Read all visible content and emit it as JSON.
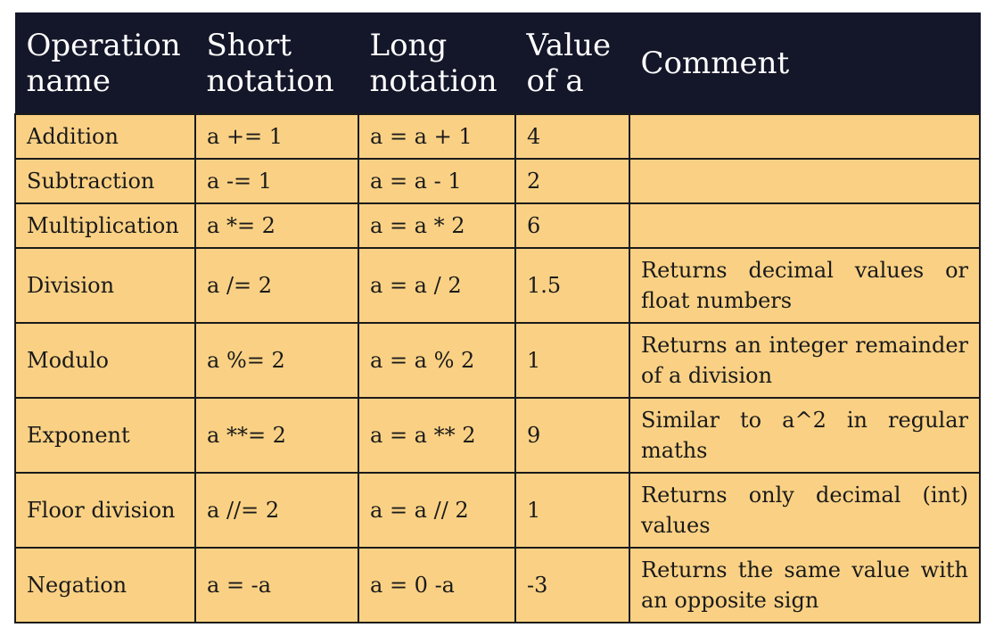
{
  "columns": [
    "Operation name",
    "Short notation",
    "Long notation",
    "Value of a",
    "Comment"
  ],
  "rows": [
    {
      "name": "Addition",
      "short": "a += 1",
      "long": "a = a + 1",
      "value": "4",
      "comment": ""
    },
    {
      "name": "Subtraction",
      "short": "a -= 1",
      "long": "a = a - 1",
      "value": "2",
      "comment": ""
    },
    {
      "name": "Multiplication",
      "short": "a *= 2",
      "long": "a = a * 2",
      "value": "6",
      "comment": ""
    },
    {
      "name": "Division",
      "short": "a /= 2",
      "long": "a = a / 2",
      "value": "1.5",
      "comment": "Returns decimal values or float numbers"
    },
    {
      "name": "Modulo",
      "short": "a %= 2",
      "long": "a = a % 2",
      "value": "1",
      "comment": "Returns an integer remainder of a division"
    },
    {
      "name": "Exponent",
      "short": "a **= 2",
      "long": "a = a ** 2",
      "value": "9",
      "comment": "Similar to a^2 in regular maths"
    },
    {
      "name": "Floor division",
      "short": "a //= 2",
      "long": "a = a // 2",
      "value": "1",
      "comment": "Returns only decimal (int) values"
    },
    {
      "name": "Negation",
      "short": "a = -a",
      "long": "a = 0 -a",
      "value": "-3",
      "comment": "Returns the same value with an opposite sign"
    }
  ]
}
